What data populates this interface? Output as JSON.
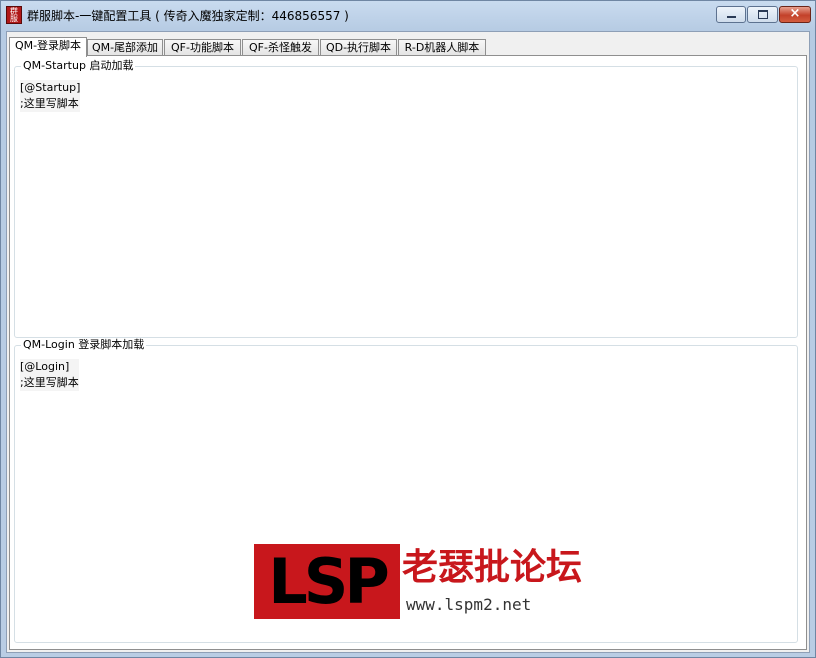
{
  "window": {
    "title": "群服脚本-一键配置工具 ( 传奇入魔独家定制：446856557 )",
    "app_icon_text": "群服",
    "buttons": {
      "minimize": "minimize",
      "maximize": "maximize",
      "close": "×"
    }
  },
  "tabs": [
    {
      "label": "QM-登录脚本",
      "active": true
    },
    {
      "label": "QM-尾部添加",
      "active": false
    },
    {
      "label": "QF-功能脚本",
      "active": false
    },
    {
      "label": "QF-杀怪触发",
      "active": false
    },
    {
      "label": "QD-执行脚本",
      "active": false
    },
    {
      "label": "R-D机器人脚本",
      "active": false
    }
  ],
  "groups": {
    "startup": {
      "label": "QM-Startup 启动加载",
      "lines": [
        "[@Startup]",
        ";这里写脚本"
      ]
    },
    "login": {
      "label": "QM-Login 登录脚本加载",
      "lines": [
        "[@Login]",
        ";这里写脚本"
      ]
    }
  },
  "watermark": {
    "brand": "LSP",
    "name": "老瑟批论坛",
    "url": "www.lspm2.net"
  },
  "colors": {
    "accent_red": "#c8171c",
    "close_button": "#c3412a"
  }
}
